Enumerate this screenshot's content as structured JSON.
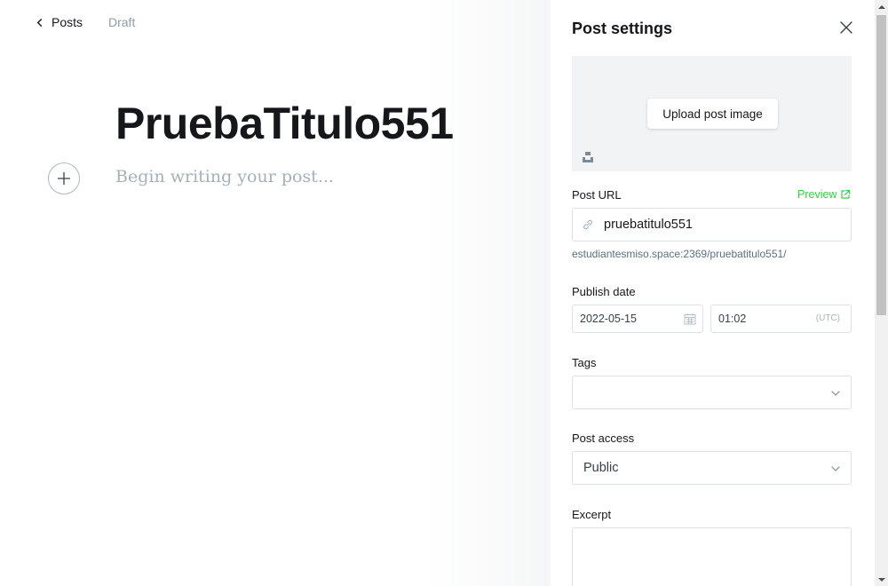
{
  "header": {
    "back_label": "Posts",
    "status": "Draft"
  },
  "editor": {
    "title": "PruebaTitulo551",
    "body_placeholder": "Begin writing your post..."
  },
  "settings": {
    "title": "Post settings",
    "upload_image_label": "Upload post image",
    "post_url": {
      "label": "Post URL",
      "preview_label": "Preview",
      "value": "pruebatitulo551",
      "full_url": "estudiantesmiso.space:2369/pruebatitulo551/"
    },
    "publish_date": {
      "label": "Publish date",
      "date": "2022-05-15",
      "time": "01:02",
      "timezone": "(UTC)"
    },
    "tags": {
      "label": "Tags",
      "value": ""
    },
    "post_access": {
      "label": "Post access",
      "value": "Public"
    },
    "excerpt": {
      "label": "Excerpt",
      "value": ""
    }
  },
  "icons": {
    "back": "chevron-left-icon",
    "plus": "plus-icon",
    "close": "close-icon",
    "unsplash": "unsplash-icon",
    "preview": "external-link-icon",
    "link": "link-icon",
    "calendar": "calendar-icon",
    "dropdown": "chevron-down-icon"
  },
  "colors": {
    "accent_green": "#30cf43",
    "muted_text": "#8e9cac",
    "border": "#dde1e5",
    "image_placeholder_bg": "#f1f3f4"
  }
}
